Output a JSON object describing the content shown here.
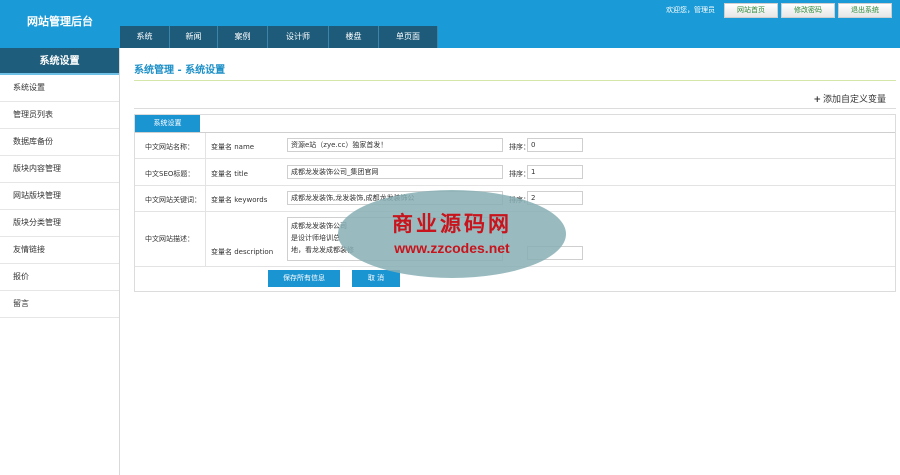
{
  "app": {
    "title": "网站管理后台"
  },
  "header": {
    "welcome": "欢迎您，管理员",
    "buttons": {
      "home": "网站首页",
      "change_password": "修改密码",
      "logout": "退出系统"
    },
    "nav": [
      "系统",
      "新闻",
      "案例",
      "设计师",
      "楼盘",
      "单页面"
    ]
  },
  "sidebar": {
    "title": "系统设置",
    "items": [
      "系统设置",
      "管理员列表",
      "数据库备份",
      "版块内容管理",
      "网站版块管理",
      "版块分类管理",
      "友情链接",
      "报价",
      "留言"
    ]
  },
  "main": {
    "breadcrumb": "系统管理 - 系统设置",
    "add_variable": "添加自定义变量",
    "tab": "系统设置",
    "var_prefix": "变量名",
    "sort_label": "排序：",
    "rows": [
      {
        "label": "中文网站名称：",
        "var": "name",
        "value": "资源e站（zye.cc）独家首发！",
        "sort": "0"
      },
      {
        "label": "中文SEO标题：",
        "var": "title",
        "value": "成都龙发装饰公司_集团官网",
        "sort": "1"
      },
      {
        "label": "中文网站关键词：",
        "var": "keywords",
        "value": "成都龙发装饰,龙发装饰,成都龙发装饰公",
        "sort": "2"
      },
      {
        "label": "中文网站描述：",
        "var": "description",
        "value_lines": [
          "成都龙发装饰公司",
          "是设计师培训总",
          "地，看龙发成都装修"
        ],
        "sort": ""
      }
    ],
    "save_button": "保存所有信息",
    "cancel_button": "取 消"
  },
  "watermark": {
    "title": "商业源码网",
    "url": "www.zzcodes.net"
  },
  "colors": {
    "header": "#1a9bd7",
    "nav_item": "#1e5b7a",
    "sidebar_title": "#1f5d7c",
    "primary_button": "#1b94d2",
    "breadcrumb": "#1b8fc7",
    "watermark_text": "#c8141c"
  }
}
